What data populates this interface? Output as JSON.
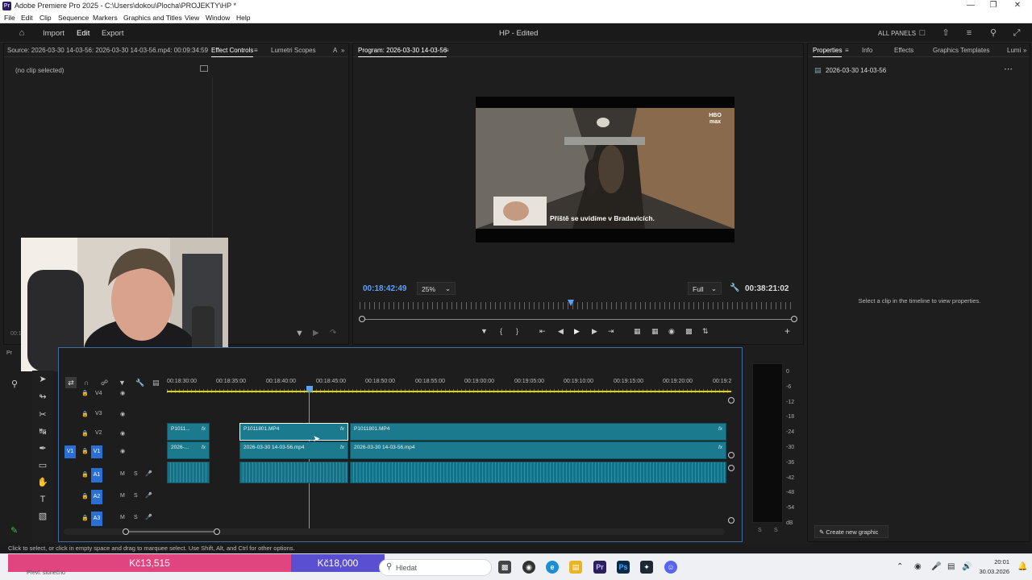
{
  "window": {
    "title": "Adobe Premiere Pro 2025 - C:\\Users\\dokou\\Plocha\\PROJEKTY\\HP *"
  },
  "menu": [
    "File",
    "Edit",
    "Clip",
    "Sequence",
    "Markers",
    "Graphics and Titles",
    "View",
    "Window",
    "Help"
  ],
  "header": {
    "import": "Import",
    "edit": "Edit",
    "export": "Export",
    "project_title": "HP - Edited",
    "all_panels": "ALL PANELS"
  },
  "source_panel": {
    "tab_source": "Source: 2026-03-30 14-03-56: 2026-03-30 14-03-56.mp4: 00:09:34:59",
    "tab_effect_controls": "Effect Controls",
    "tab_lumetri": "Lumetri Scopes",
    "tab_overflow": "A",
    "no_clip": "(no clip selected)",
    "partial_timecode": "00:1"
  },
  "program_panel": {
    "tab": "Program: 2026-03-30 14-03-56",
    "subtitle": "Příště se uvidíme v Bradavicích.",
    "watermark": "HBO max",
    "current_timecode": "00:18:42:49",
    "zoom": "25%",
    "quality": "Full",
    "duration": "00:38:21:02",
    "playhead_fraction": 0.49
  },
  "properties_panel": {
    "tabs": [
      "Properties",
      "Info",
      "Effects",
      "Graphics Templates",
      "Lumi"
    ],
    "clip_name": "2026-03-30 14-03-56",
    "hint": "Select a clip in the timeline to view properties.",
    "create_graphic": "Create new graphic"
  },
  "timeline": {
    "tab_partial": "Pr",
    "ruler_ticks": [
      "00:18:30:00",
      "00:18:35:00",
      "00:18:40:00",
      "00:18:45:00",
      "00:18:50:00",
      "00:18:55:00",
      "00:19:00:00",
      "00:19:05:00",
      "00:19:10:00",
      "00:19:15:00",
      "00:19:20:00",
      "00:19:2"
    ],
    "tracks": {
      "v4": "V4",
      "v3": "V3",
      "v2": "V2",
      "v1": "V1",
      "src_v1": "V1",
      "a1": "A1",
      "a2": "A2",
      "a3": "A3",
      "m": "M",
      "s": "S"
    },
    "clips": {
      "v2_a": "P1011...",
      "v2_b": "P1011801.MP4",
      "v2_c": "P1011801.MP4",
      "v1_a": "2026-...",
      "v1_b": "2026-03-30 14-03-56.mp4",
      "v1_c": "2026-03-30 14-03-56.mp4",
      "fx": "fx"
    }
  },
  "meter": {
    "scale": [
      "0",
      "-6",
      "-12",
      "-18",
      "-24",
      "-30",
      "-36",
      "-42",
      "-48",
      "-54",
      "dB"
    ],
    "solo": [
      "S",
      "S"
    ]
  },
  "status_bar": "Click to select, or click in empty space and drag to marquee select. Use Shift, Alt, and Ctrl for other options.",
  "taskbar": {
    "price_1": "Kč13,515",
    "price_2": "Kč18,000",
    "weather": "Převl. slunečno",
    "search_placeholder": "Hledat",
    "time": "20:01",
    "date": "30.03.2026"
  }
}
